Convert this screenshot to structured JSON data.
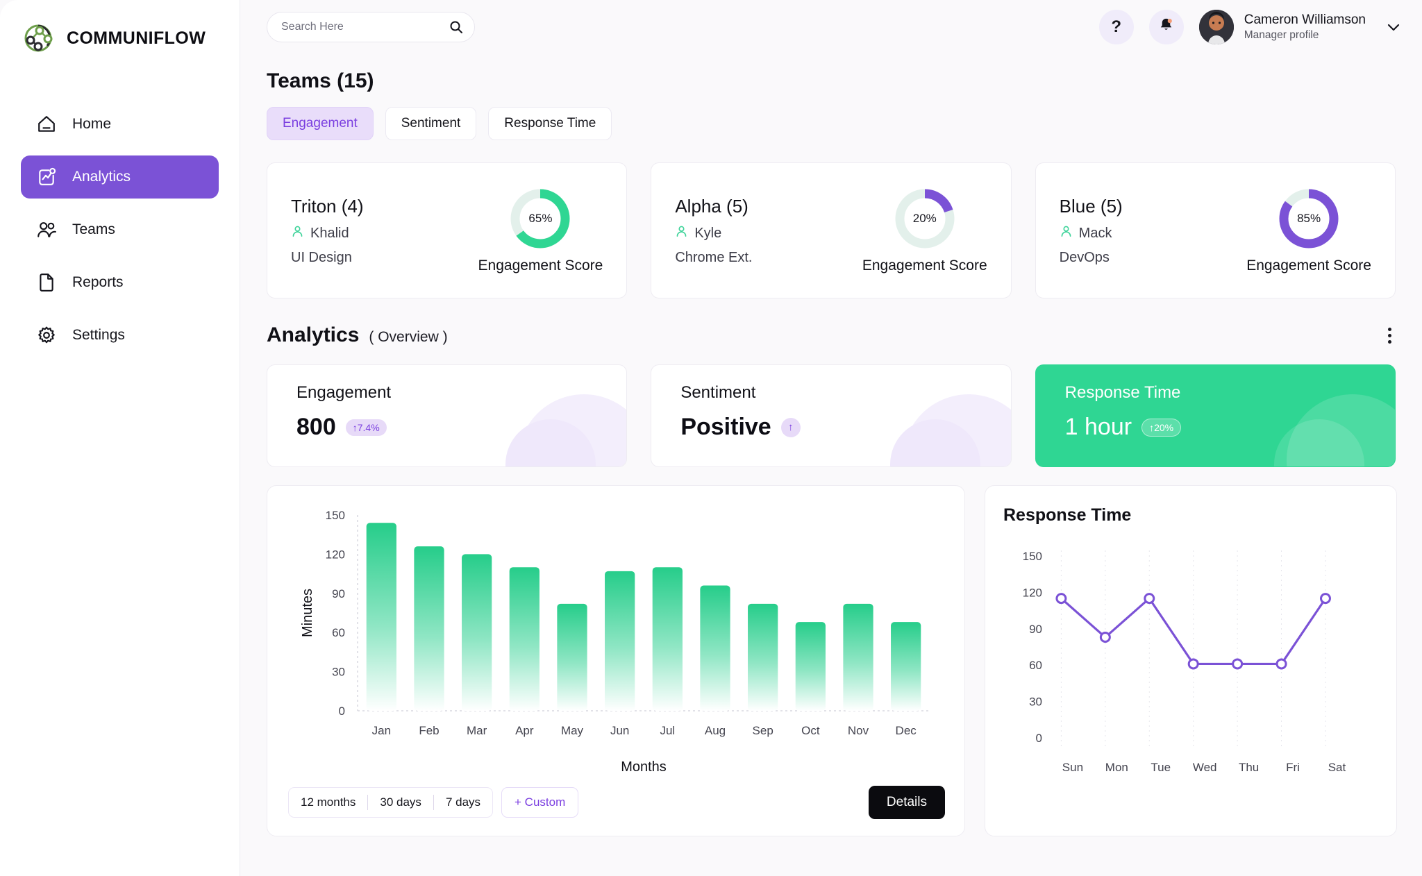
{
  "brand": {
    "name": "COMMUNIFLOW",
    "logo_icon": "network-nodes-icon",
    "accent_purple": "#7b52d6",
    "accent_green": "#2fd693"
  },
  "sidebar": {
    "items": [
      {
        "label": "Home",
        "icon": "home-icon",
        "active": false
      },
      {
        "label": "Analytics",
        "icon": "analytics-chart-icon",
        "active": true
      },
      {
        "label": "Teams",
        "icon": "people-icon",
        "active": false
      },
      {
        "label": "Reports",
        "icon": "document-icon",
        "active": false
      },
      {
        "label": "Settings",
        "icon": "gear-icon",
        "active": false
      }
    ]
  },
  "topbar": {
    "search": {
      "placeholder": "Search Here",
      "value": "",
      "icon": "search-icon"
    },
    "help_icon": "question-mark-icon",
    "help_label": "?",
    "notification_icon": "bell-icon",
    "user": {
      "name": "Cameron Williamson",
      "role": "Manager profile",
      "avatar": "user-avatar",
      "chevron": "chevron-down-icon"
    }
  },
  "teams_section": {
    "title": "Teams (15)",
    "tabs": [
      {
        "label": "Engagement",
        "active": true
      },
      {
        "label": "Sentiment",
        "active": false
      },
      {
        "label": "Response Time",
        "active": false
      }
    ],
    "cards": [
      {
        "name": "Triton (4)",
        "owner": "Khalid",
        "dept": "UI Design",
        "score_label": "Engagement Score",
        "percent": 65,
        "percent_text": "65%",
        "color": "#2fd693"
      },
      {
        "name": "Alpha (5)",
        "owner": "Kyle",
        "dept": "Chrome Ext.",
        "score_label": "Engagement Score",
        "percent": 20,
        "percent_text": "20%",
        "color": "#7b52d6"
      },
      {
        "name": "Blue (5)",
        "owner": "Mack",
        "dept": "DevOps",
        "score_label": "Engagement Score",
        "percent": 85,
        "percent_text": "85%",
        "color": "#7b52d6"
      }
    ]
  },
  "analytics_section": {
    "title": "Analytics",
    "subtitle": "( Overview )",
    "menu_icon": "kebab-menu-icon",
    "kpis": [
      {
        "title": "Engagement",
        "value": "800",
        "badge": "↑7.4%",
        "highlight": false
      },
      {
        "title": "Sentiment",
        "value": "Positive",
        "badge": "↑",
        "highlight": false
      },
      {
        "title": "Response Time",
        "value": "1 hour",
        "badge": "↑20%",
        "highlight": true
      }
    ]
  },
  "bar_chart_card": {
    "range_options": [
      "12 months",
      "30 days",
      "7 days"
    ],
    "custom_label": "+ Custom",
    "details_label": "Details"
  },
  "line_chart_card": {
    "title": "Response Time"
  },
  "chart_data": [
    {
      "type": "bar",
      "title": "",
      "categories": [
        "Jan",
        "Feb",
        "Mar",
        "Apr",
        "May",
        "Jun",
        "Jul",
        "Aug",
        "Sep",
        "Oct",
        "Nov",
        "Dec"
      ],
      "values": [
        144,
        126,
        120,
        110,
        82,
        107,
        110,
        96,
        82,
        68,
        82,
        68
      ],
      "xlabel": "Months",
      "ylabel": "Minutes",
      "ylim": [
        0,
        150
      ],
      "yticks": [
        0,
        30,
        60,
        90,
        120,
        150
      ],
      "grid": false,
      "color": "#2fd693",
      "legend": "none"
    },
    {
      "type": "line",
      "title": "Response Time",
      "x": [
        "Sun",
        "Mon",
        "Tue",
        "Wed",
        "Thu",
        "Fri",
        "Sat"
      ],
      "values": [
        115,
        83,
        115,
        61,
        61,
        61,
        115
      ],
      "xlabel": "",
      "ylabel": "",
      "ylim": [
        0,
        150
      ],
      "yticks": [
        0,
        30,
        60,
        90,
        120,
        150
      ],
      "grid": true,
      "color": "#7b52d6",
      "legend": "none"
    }
  ]
}
